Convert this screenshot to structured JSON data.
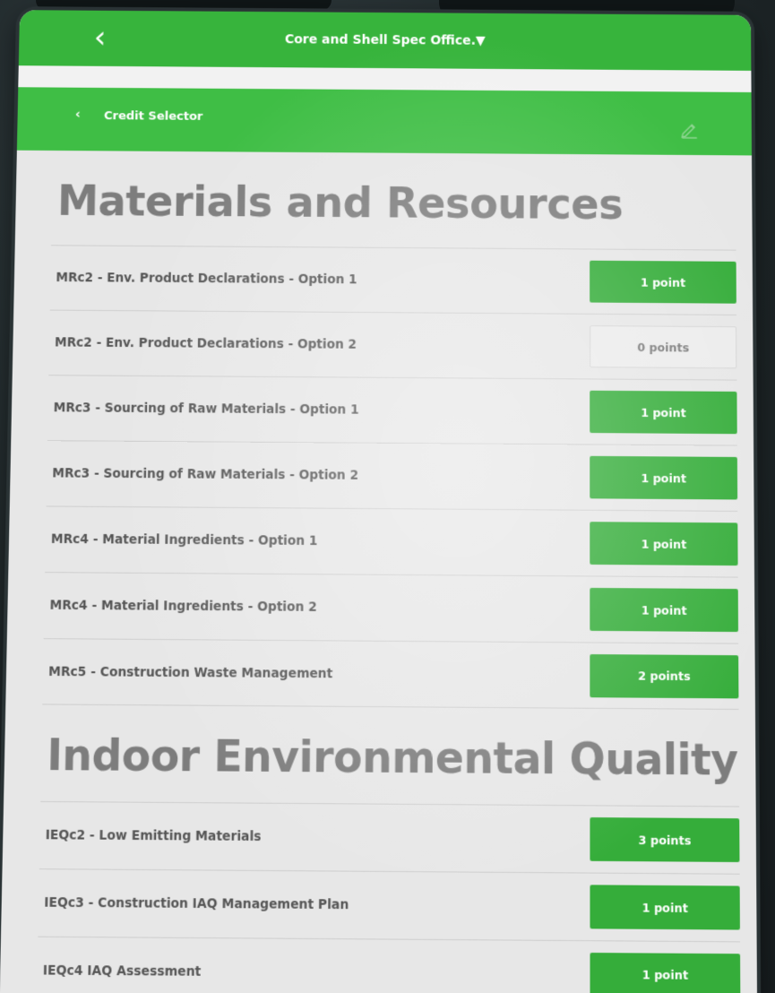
{
  "header": {
    "title": "Core and Shell Spec Office.▼",
    "back_glyph": "‹"
  },
  "subheader": {
    "back_glyph": "‹",
    "title": "Credit Selector"
  },
  "sections": [
    {
      "title": "Materials and Resources",
      "credits": [
        {
          "label": "MRc2 - Env. Product Declarations - Option 1",
          "points": "1 point"
        },
        {
          "label": "MRc2 - Env. Product Declarations - Option 2",
          "points": "0 points"
        },
        {
          "label": "MRc3 - Sourcing of Raw Materials - Option 1",
          "points": "1 point"
        },
        {
          "label": "MRc3 - Sourcing of Raw Materials - Option 2",
          "points": "1 point"
        },
        {
          "label": "MRc4 - Material Ingredients - Option 1",
          "points": "1 point"
        },
        {
          "label": "MRc4 - Material Ingredients - Option 2",
          "points": "1 point"
        },
        {
          "label": "MRc5 - Construction Waste Management",
          "points": "2 points"
        }
      ]
    },
    {
      "title": "Indoor Environmental Quality",
      "credits": [
        {
          "label": "IEQc2 - Low Emitting Materials",
          "points": "3 points"
        },
        {
          "label": "IEQc3 - Construction IAQ Management Plan",
          "points": "1 point"
        },
        {
          "label": "IEQc4 IAQ Assessment",
          "points": "1 point"
        }
      ]
    }
  ],
  "colors": {
    "app_bar": "#37b43c",
    "sub_bar": "#3fbe45",
    "point_button": "#35ad3a",
    "zero_button": "#ececec"
  },
  "icons": {
    "back": "chevron-left-icon",
    "edit": "pencil-icon"
  }
}
